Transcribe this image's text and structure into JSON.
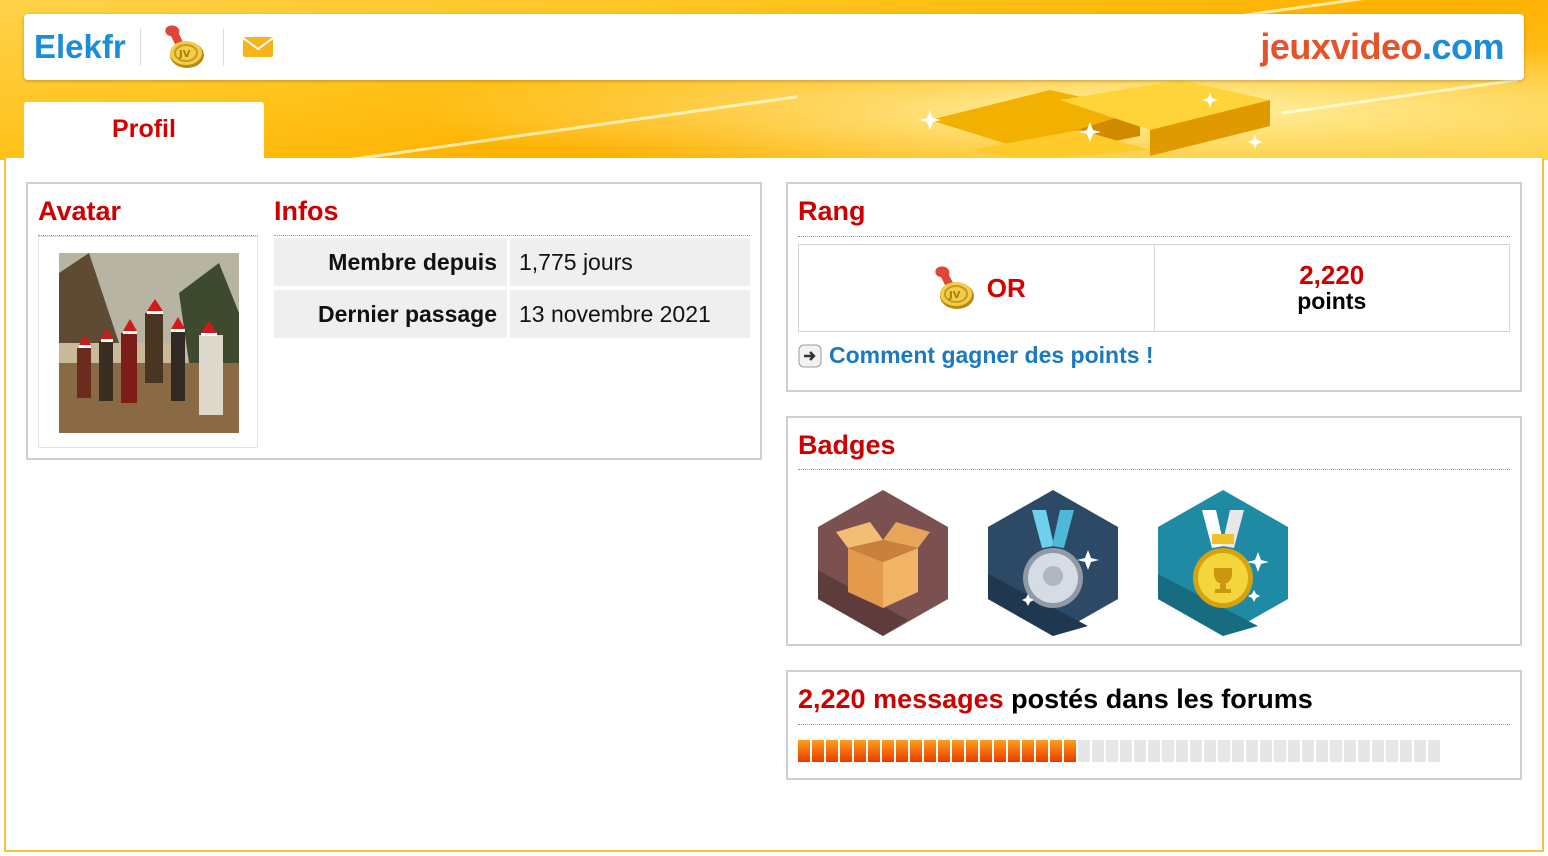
{
  "header": {
    "username": "Elekfr",
    "rank_icon": "gold-medal-icon",
    "mail_icon": "envelope-icon",
    "site_logo_part1": "jeuxvideo",
    "site_logo_part2": ".com"
  },
  "tabs": [
    {
      "label": "Profil",
      "active": true
    }
  ],
  "avatar": {
    "title": "Avatar"
  },
  "infos": {
    "title": "Infos",
    "rows": [
      {
        "label": "Membre depuis",
        "value": "1,775 jours"
      },
      {
        "label": "Dernier passage",
        "value": "13 novembre 2021"
      }
    ]
  },
  "rang": {
    "title": "Rang",
    "rank_name": "OR",
    "points_value": "2,220",
    "points_label": "points",
    "howto_link": "Comment gagner des points !"
  },
  "badges": {
    "title": "Badges",
    "items": [
      {
        "icon": "open-box-badge-icon"
      },
      {
        "icon": "silver-medal-badge-icon"
      },
      {
        "icon": "gold-trophy-medal-badge-icon"
      }
    ]
  },
  "messages": {
    "count": "2,220 messages",
    "suffix": " postés dans les forums",
    "progress_fraction": 0.43
  },
  "colors": {
    "accent_red": "#cc0000",
    "link_blue": "#1a79c2",
    "banner_gold": "#ffc21a"
  }
}
